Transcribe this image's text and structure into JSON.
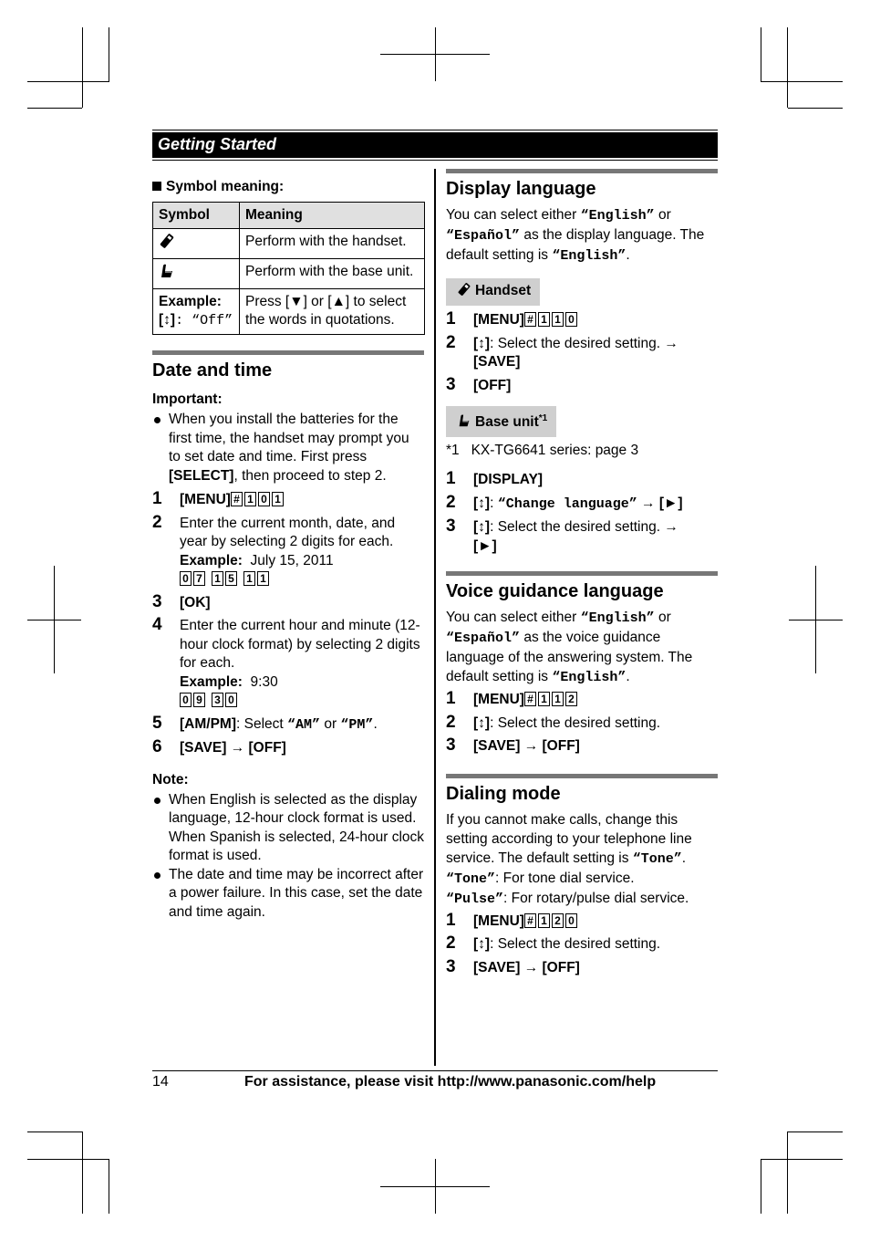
{
  "header": {
    "section_title": "Getting Started"
  },
  "symbol_meaning": {
    "heading": "Symbol meaning:",
    "columns": [
      "Symbol",
      "Meaning"
    ],
    "rows": [
      {
        "symbol_icon": "handset-icon",
        "meaning": "Perform with the handset."
      },
      {
        "symbol_icon": "base-unit-icon",
        "meaning": "Perform with the base unit."
      },
      {
        "symbol_label": "Example:",
        "symbol_key": "[↕]",
        "symbol_quote": ": “Off”",
        "meaning": "Press [▼] or [▲] to select the words in quotations."
      }
    ]
  },
  "date_and_time": {
    "title": "Date and time",
    "important_label": "Important:",
    "important_bullet": "When you install the batteries for the first time, the handset may prompt you to set date and time. First press",
    "important_key": "[SELECT]",
    "important_tail": ", then proceed to step 2.",
    "steps": [
      {
        "num": "1",
        "key": "[MENU]",
        "boxes": [
          "#",
          "1",
          "0",
          "1"
        ]
      },
      {
        "num": "2",
        "text": "Enter the current month, date, and year by selecting 2 digits for each.",
        "example_label": "Example:",
        "example_value": "July 15, 2011",
        "boxes": [
          [
            "0",
            "7"
          ],
          [
            "1",
            "5"
          ],
          [
            "1",
            "1"
          ]
        ]
      },
      {
        "num": "3",
        "key": "[OK]"
      },
      {
        "num": "4",
        "text": "Enter the current hour and minute (12-hour clock format) by selecting 2 digits for each.",
        "example_label": "Example:",
        "example_value": "9:30",
        "boxes": [
          [
            "0",
            "9"
          ],
          [
            "3",
            "0"
          ]
        ]
      },
      {
        "num": "5",
        "key": "[AM/PM]",
        "text_a": ": Select ",
        "opt1": "“AM”",
        "text_b": " or ",
        "opt2": "“PM”",
        "text_c": "."
      },
      {
        "num": "6",
        "key": "[SAVE]",
        "arrow": " → ",
        "key2": "[OFF]"
      }
    ],
    "note_label": "Note:",
    "notes": [
      "When English is selected as the display language, 12-hour clock format is used. When Spanish is selected, 24-hour clock format is used.",
      "The date and time may be incorrect after a power failure. In this case, set the date and time again."
    ]
  },
  "display_language": {
    "title": "Display language",
    "intro_a": "You can select either ",
    "opt1": "“English”",
    "intro_b": " or ",
    "opt2": "“Español”",
    "intro_c": " as the display language. The default setting is ",
    "default": "“English”",
    "intro_d": ".",
    "handset_tag": "Handset",
    "handset_steps": [
      {
        "num": "1",
        "key": "[MENU]",
        "boxes": [
          "#",
          "1",
          "1",
          "0"
        ]
      },
      {
        "num": "2",
        "key": "[↕]",
        "text": ": Select the desired setting. →",
        "key2": "[SAVE]"
      },
      {
        "num": "3",
        "key": "[OFF]"
      }
    ],
    "base_tag": "Base unit",
    "base_tag_sup": "*1",
    "footnote_mark": "*1",
    "footnote_text": "KX-TG6641 series: page 3",
    "base_steps": [
      {
        "num": "1",
        "key": "[DISPLAY]"
      },
      {
        "num": "2",
        "key": "[↕]",
        "text": ": ",
        "quote": "“Change language”",
        "arrow": " → ",
        "key2": "[►]"
      },
      {
        "num": "3",
        "key": "[↕]",
        "text": ": Select the desired setting. →",
        "key2": "[►]"
      }
    ]
  },
  "voice_guidance": {
    "title": "Voice guidance language",
    "intro_a": "You can select either ",
    "opt1": "“English”",
    "intro_b": " or ",
    "opt2": "“Español”",
    "intro_c": " as the voice guidance language of the answering system. The default setting is ",
    "default": "“English”",
    "intro_d": ".",
    "steps": [
      {
        "num": "1",
        "key": "[MENU]",
        "boxes": [
          "#",
          "1",
          "1",
          "2"
        ]
      },
      {
        "num": "2",
        "key": "[↕]",
        "text": ": Select the desired setting."
      },
      {
        "num": "3",
        "key": "[SAVE]",
        "arrow": " → ",
        "key2": "[OFF]"
      }
    ]
  },
  "dialing_mode": {
    "title": "Dialing mode",
    "intro": "If you cannot make calls, change this setting according to your telephone line service. The default setting is ",
    "default": "“Tone”",
    "intro_end": ".",
    "tone_opt": "“Tone”",
    "tone_desc": ": For tone dial service.",
    "pulse_opt": "“Pulse”",
    "pulse_desc": ": For rotary/pulse dial service.",
    "steps": [
      {
        "num": "1",
        "key": "[MENU]",
        "boxes": [
          "#",
          "1",
          "2",
          "0"
        ]
      },
      {
        "num": "2",
        "key": "[↕]",
        "text": ": Select the desired setting."
      },
      {
        "num": "3",
        "key": "[SAVE]",
        "arrow": " → ",
        "key2": "[OFF]"
      }
    ]
  },
  "footer": {
    "page_number": "14",
    "assistance": "For assistance, please visit http://www.panasonic.com/help"
  }
}
